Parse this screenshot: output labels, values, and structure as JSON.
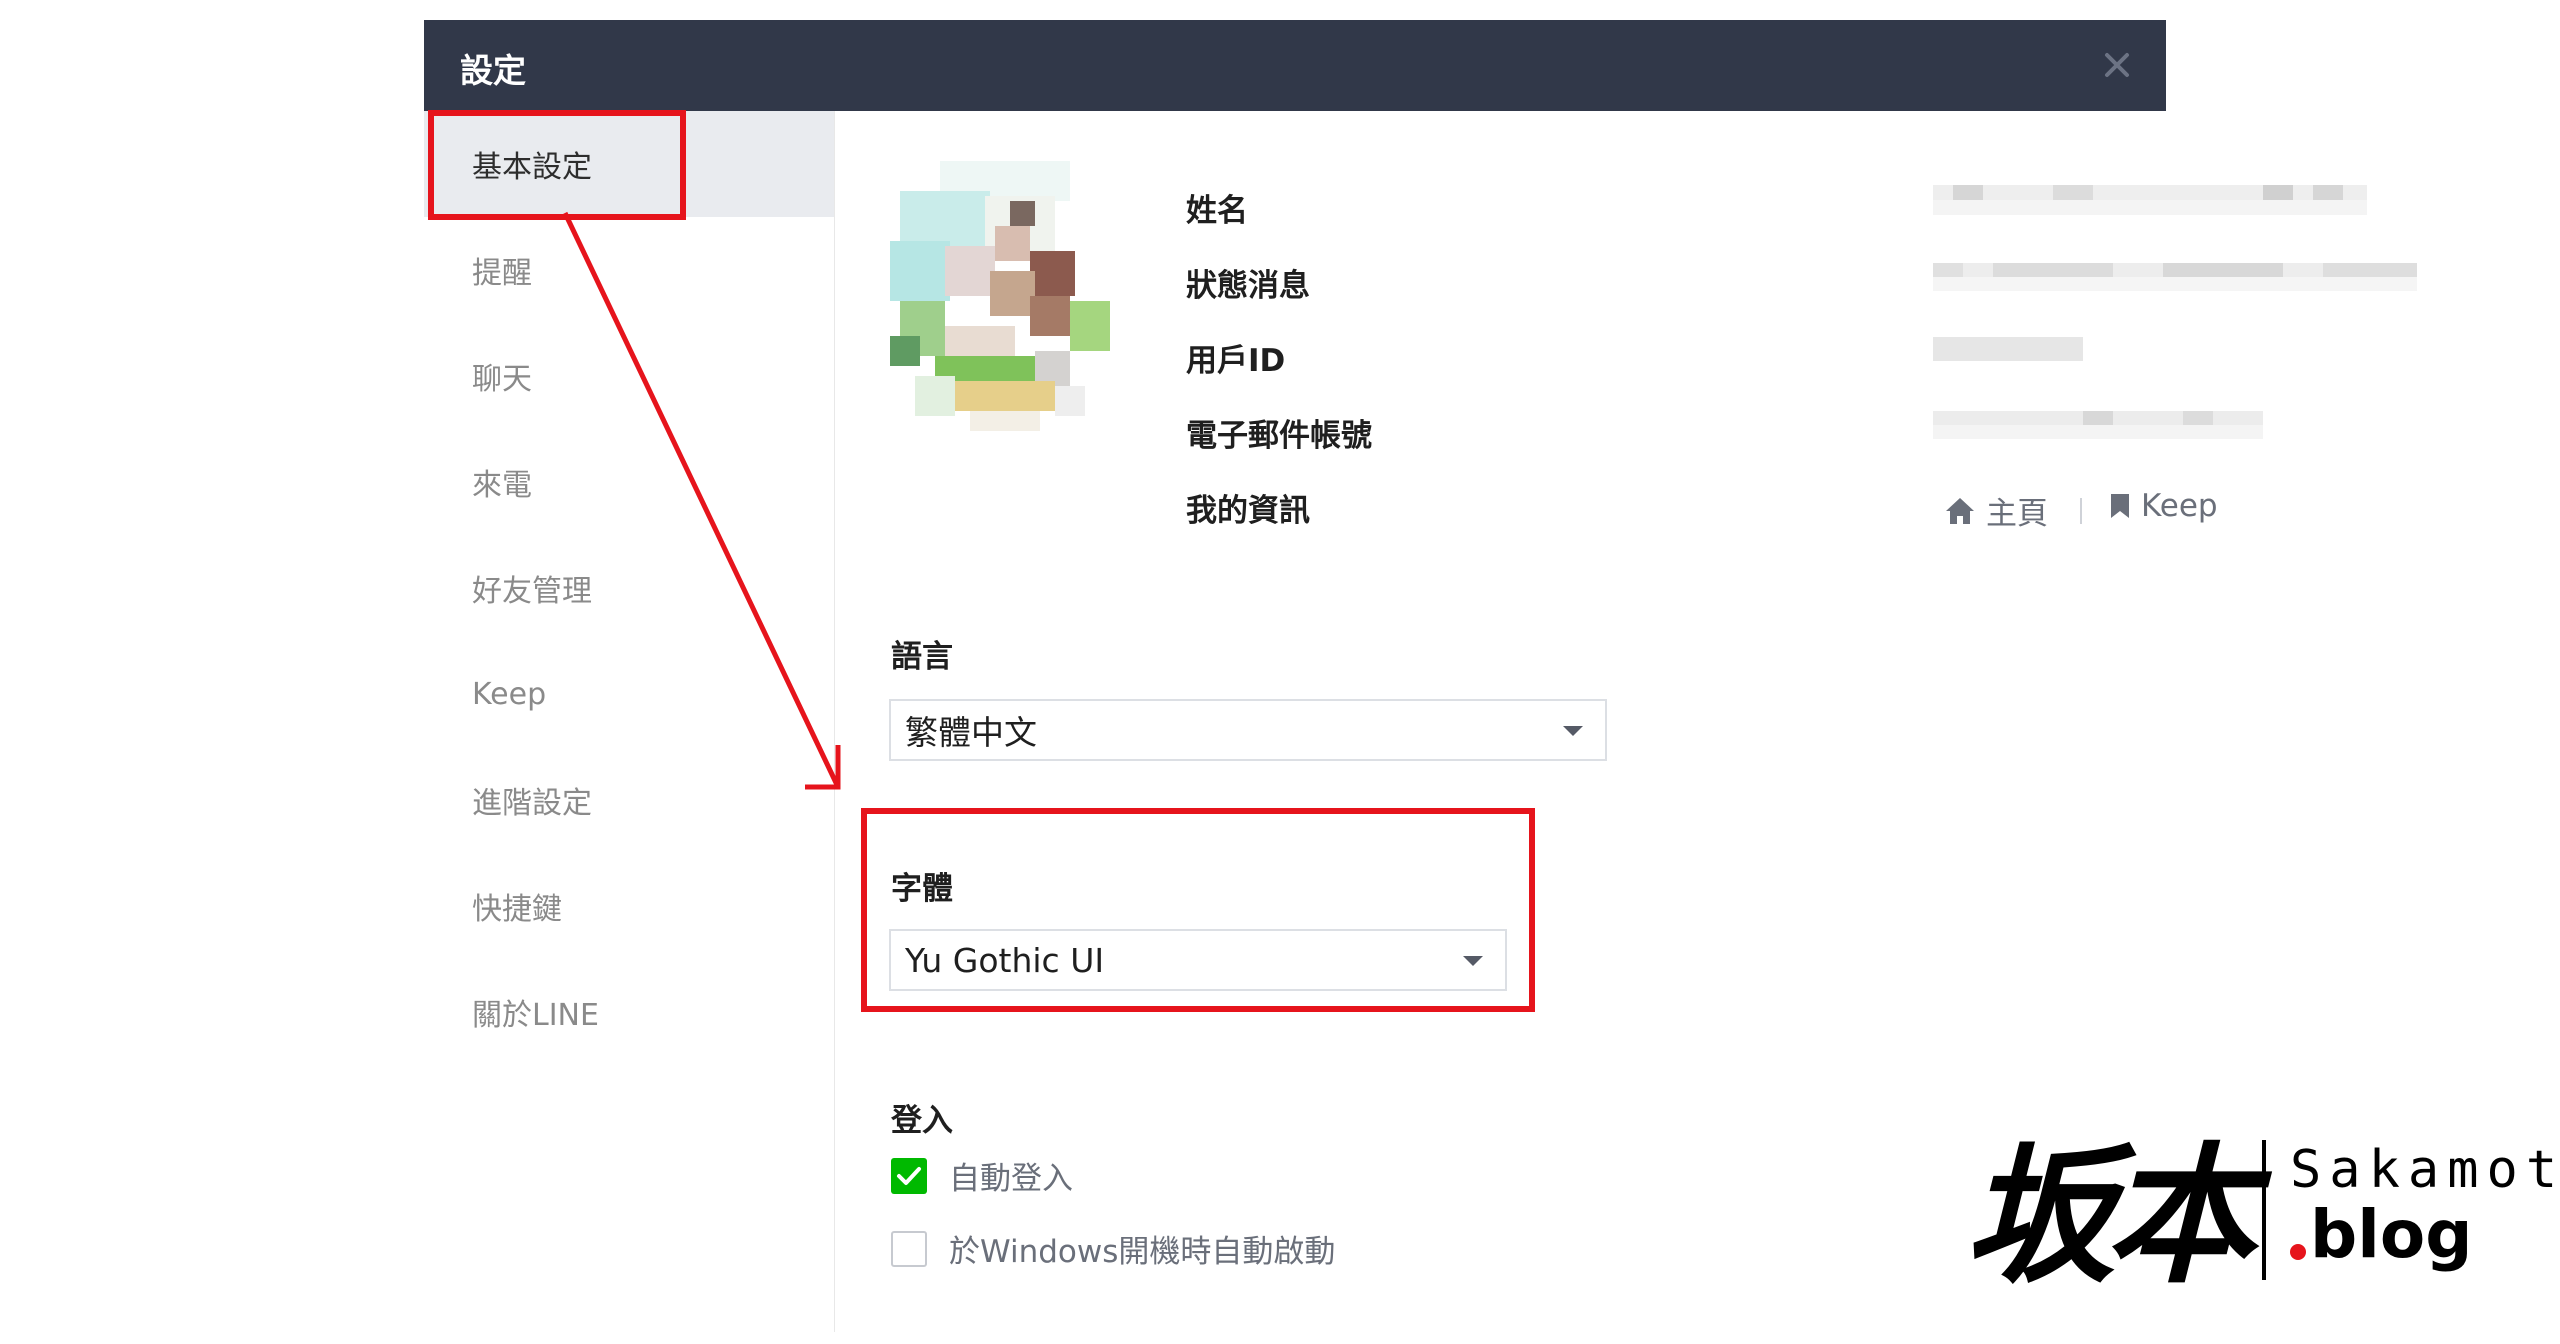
{
  "window": {
    "title": "設定",
    "close_icon": "close-icon"
  },
  "sidebar": {
    "items": [
      {
        "label": "基本設定",
        "active": true
      },
      {
        "label": "提醒",
        "active": false
      },
      {
        "label": "聊天",
        "active": false
      },
      {
        "label": "來電",
        "active": false
      },
      {
        "label": "好友管理",
        "active": false
      },
      {
        "label": "Keep",
        "active": false
      },
      {
        "label": "進階設定",
        "active": false
      },
      {
        "label": "快捷鍵",
        "active": false
      },
      {
        "label": "關於LINE",
        "active": false
      }
    ]
  },
  "profile": {
    "name_label": "姓名",
    "status_label": "狀態消息",
    "userid_label": "用戶ID",
    "email_label": "電子郵件帳號",
    "myinfo_label": "我的資訊",
    "links": {
      "home": {
        "label": "主頁",
        "icon": "home-icon"
      },
      "keep": {
        "label": "Keep",
        "icon": "bookmark-icon"
      }
    }
  },
  "language": {
    "label": "語言",
    "value": "繁體中文"
  },
  "font": {
    "label": "字體",
    "value": "Yu Gothic UI"
  },
  "login": {
    "label": "登入",
    "options": [
      {
        "label": "自動登入",
        "checked": true
      },
      {
        "label": "於Windows開機時自動啟動",
        "checked": false
      }
    ]
  },
  "watermark": {
    "kanji": "坂本",
    "latin": "Sakamoto",
    "blog": "blog"
  },
  "colors": {
    "titlebar": "#313849",
    "accent_green": "#00b900",
    "annotation_red": "#e6141c"
  }
}
